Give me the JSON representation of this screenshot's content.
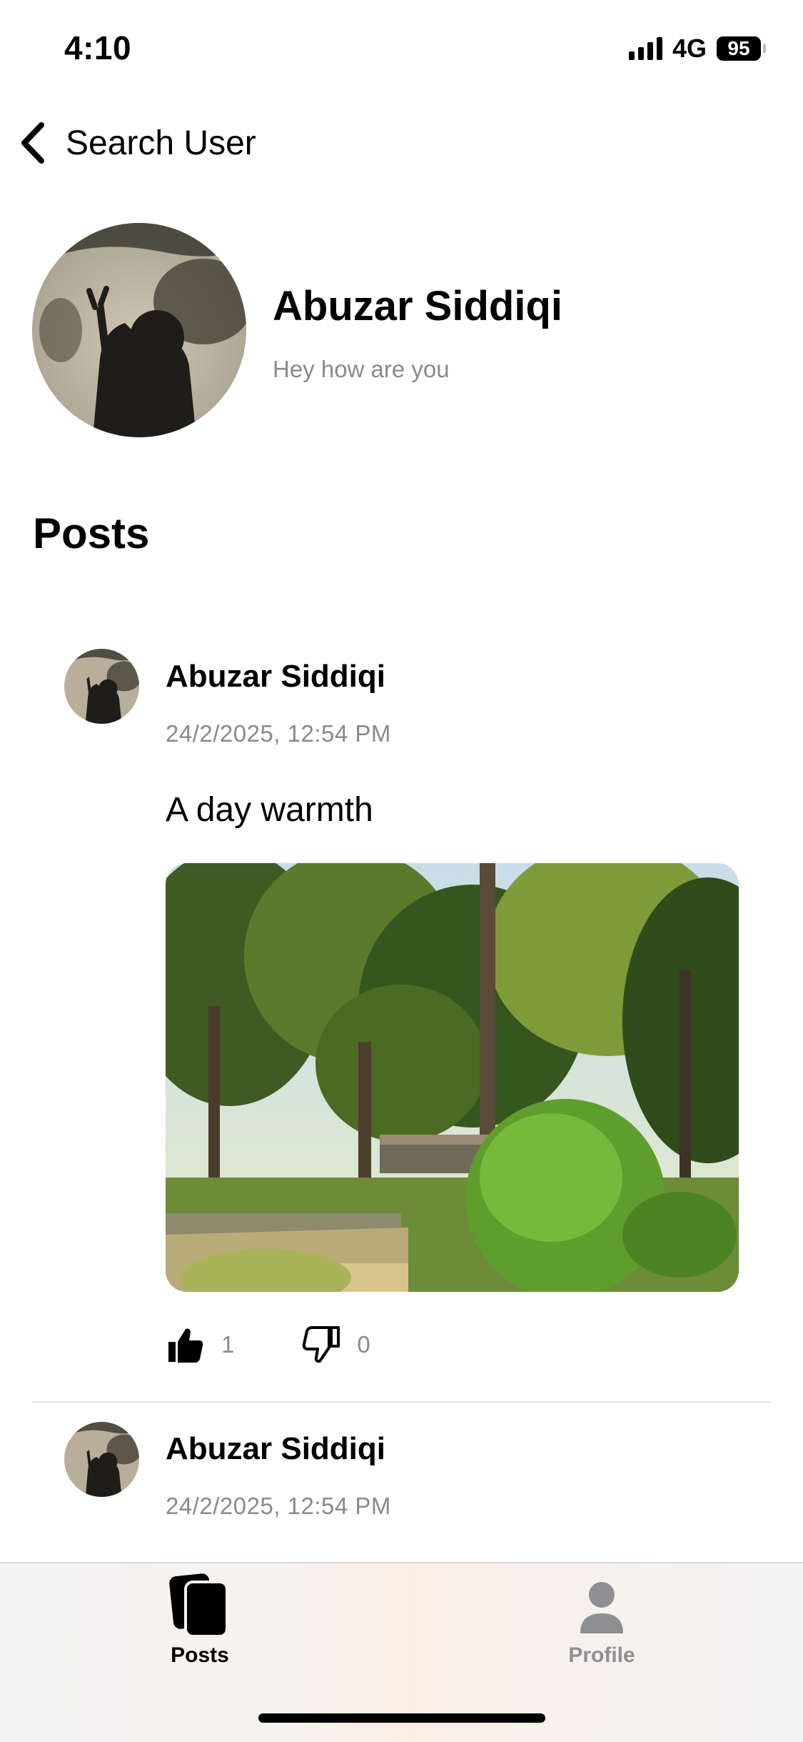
{
  "status_bar": {
    "time": "4:10",
    "network": "4G",
    "battery": "95"
  },
  "nav": {
    "back_label": "Search User"
  },
  "profile": {
    "name": "Abuzar Siddiqi",
    "status": "Hey how are you"
  },
  "section_title": "Posts",
  "posts": [
    {
      "author": "Abuzar Siddiqi",
      "timestamp": "24/2/2025, 12:54 PM",
      "text": "A day warmth",
      "likes": "1",
      "dislikes": "0"
    },
    {
      "author": "Abuzar Siddiqi",
      "timestamp": "24/2/2025, 12:54 PM"
    }
  ],
  "tab_bar": {
    "tabs": [
      {
        "label": "Posts",
        "icon": "posts-cards-icon",
        "active": true
      },
      {
        "label": "Profile",
        "icon": "person-icon",
        "active": false
      }
    ]
  },
  "colors": {
    "secondary_text": "#8a8a8e",
    "divider": "#e3e3e6",
    "inactive_tab": "#8e8e93"
  }
}
